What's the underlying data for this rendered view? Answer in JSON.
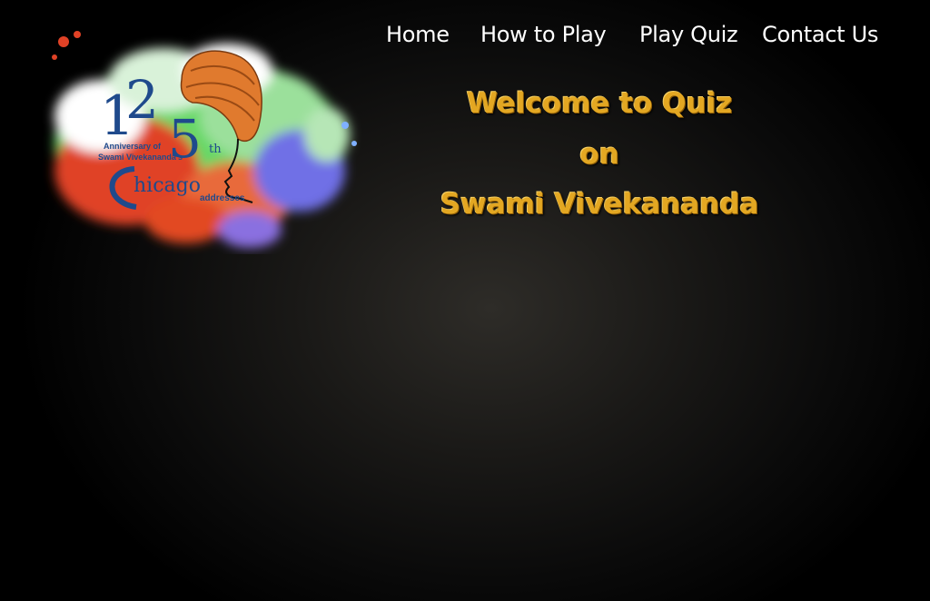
{
  "logo": {
    "number_1": "1",
    "number_2": "2",
    "number_5": "5",
    "suffix": "th",
    "line1": "Anniversary of",
    "line2": "Swami Vivekananda's",
    "chicago": "hicago",
    "addresses": "addresses"
  },
  "nav": {
    "home": "Home",
    "how_to_play": "How to Play",
    "play_quiz": "Play Quiz",
    "contact_us": "Contact Us"
  },
  "welcome": {
    "line1": "Welcome to Quiz",
    "line2": "on",
    "line3": "Swami Vivekananda"
  },
  "colors": {
    "heading": "#e3a722",
    "nav_text": "#ffffff",
    "logo_blue": "#1f4a8c",
    "turban": "#e07a2e"
  }
}
